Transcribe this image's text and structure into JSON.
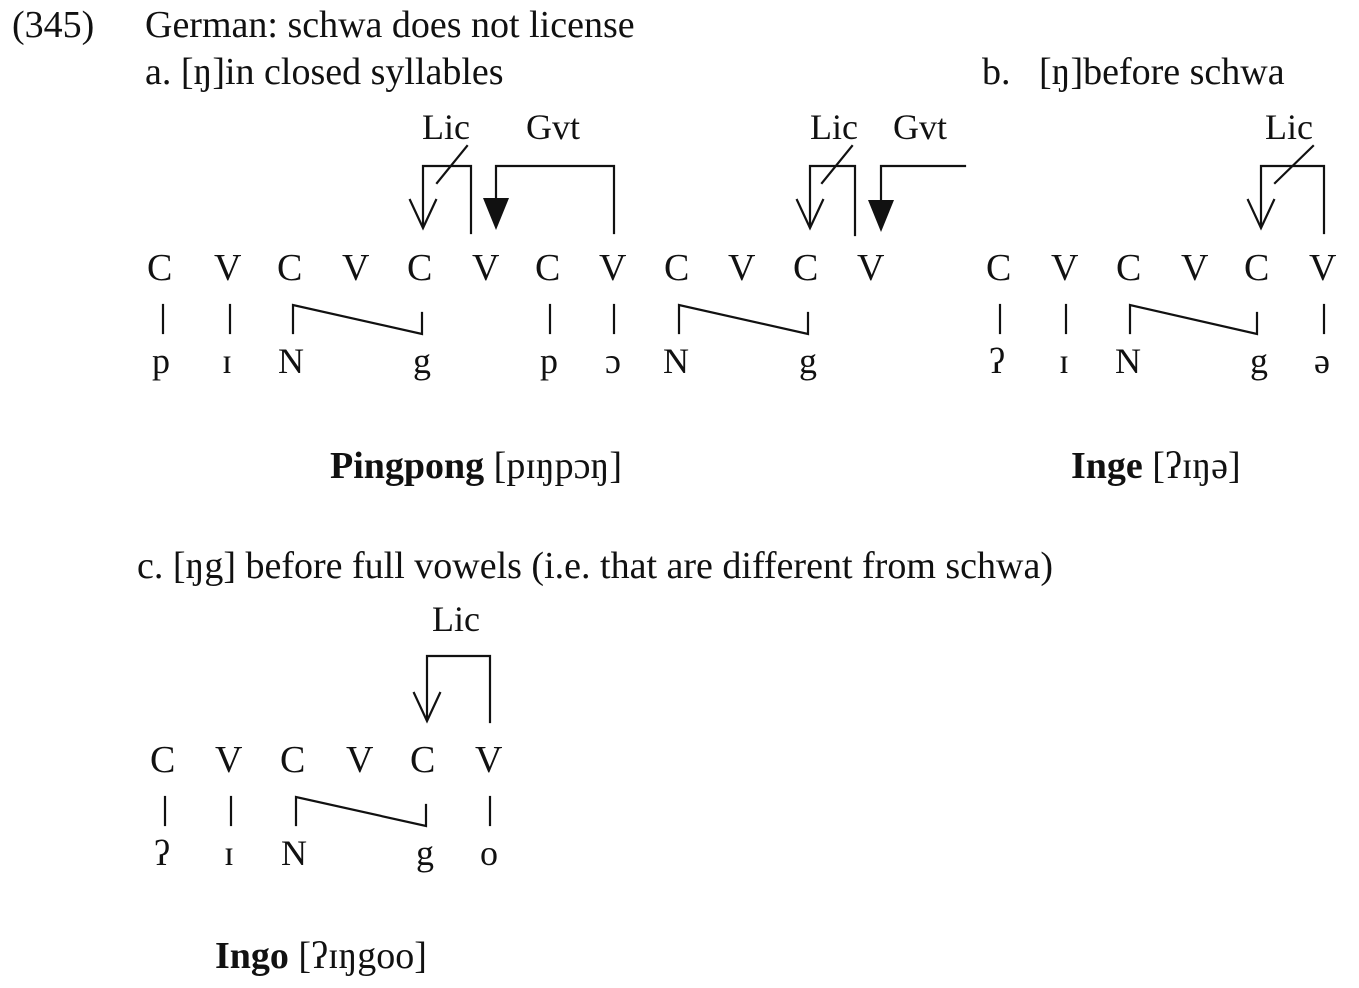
{
  "example": {
    "number": "(345)",
    "title": "German: schwa does not license"
  },
  "panel_a": {
    "label": "a. [ŋ]in closed syllables",
    "annotations": {
      "lic_1": "Lic",
      "gvt_1": "Gvt",
      "lic_2": "Lic",
      "gvt_2": "Gvt"
    },
    "skeleton": [
      "C",
      "V",
      "C",
      "V",
      "C",
      "V",
      "C",
      "V",
      "C",
      "V",
      "C",
      "V"
    ],
    "melody": [
      "p",
      "ɪ",
      "N",
      "g",
      "p",
      "ɔ",
      "N",
      "g"
    ],
    "gloss_word": "Pingpong",
    "gloss_ipa": "[pɪŋpɔŋ]"
  },
  "panel_b": {
    "label": "b.   [ŋ]before schwa",
    "annotations": {
      "lic": "Lic"
    },
    "skeleton": [
      "C",
      "V",
      "C",
      "V",
      "C",
      "V"
    ],
    "melody": [
      "ʔ",
      "ɪ",
      "N",
      "g",
      "ə"
    ],
    "gloss_word": "Inge",
    "gloss_ipa": "[ʔɪŋə]"
  },
  "panel_c": {
    "label": "c. [ŋg] before full vowels (i.e. that are different from schwa)",
    "annotations": {
      "lic": "Lic"
    },
    "skeleton": [
      "C",
      "V",
      "C",
      "V",
      "C",
      "V"
    ],
    "melody": [
      "ʔ",
      "ɪ",
      "N",
      "g",
      "o"
    ],
    "gloss_word": "Ingo",
    "gloss_ipa": "[ʔɪŋgoo]"
  }
}
